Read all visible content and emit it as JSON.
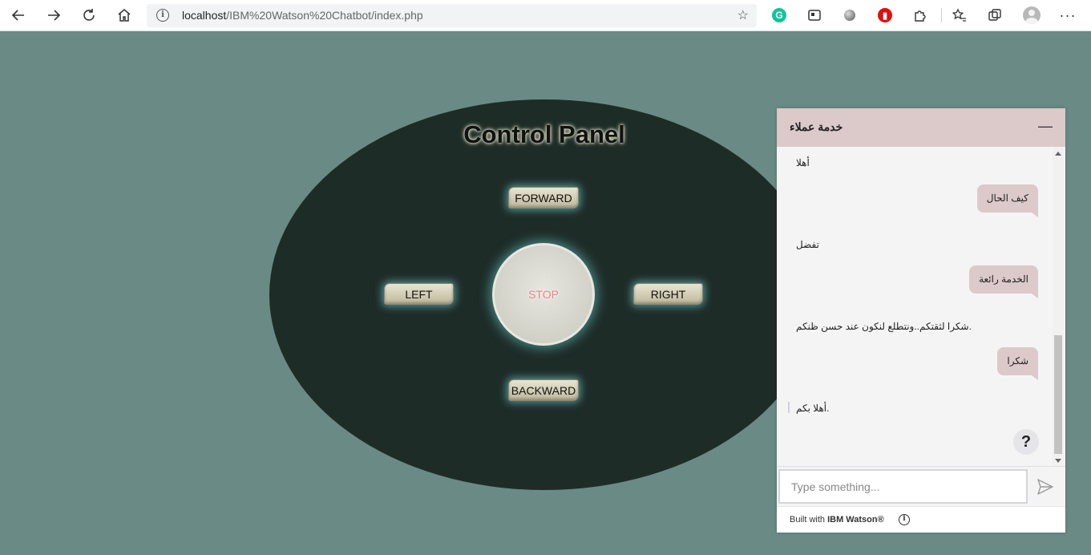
{
  "browser": {
    "url_host": "localhost",
    "url_path": "/IBM%20Watson%20Chatbot/index.php"
  },
  "control_panel": {
    "title": "Control Panel",
    "forward": "FORWARD",
    "backward": "BACKWARD",
    "left": "LEFT",
    "right": "RIGHT",
    "stop": "STOP"
  },
  "chat": {
    "title": "خدمة عملاء",
    "minimize": "—",
    "messages": [
      {
        "from": "bot",
        "text": "أهلا"
      },
      {
        "from": "user",
        "text": "كيف الحال"
      },
      {
        "from": "bot",
        "text": "تفضل"
      },
      {
        "from": "user",
        "text": "الخدمة رائعة"
      },
      {
        "from": "bot",
        "text": "شكرا لثقتكم..ونتطلع لنكون عند حسن ظنكم."
      },
      {
        "from": "user",
        "text": "شكرا"
      },
      {
        "from": "bot",
        "text": "أهلا بكم."
      }
    ],
    "help": "?",
    "input_placeholder": "Type something...",
    "footer_prefix": "Built with ",
    "footer_brand": "IBM Watson®",
    "info": "i"
  }
}
